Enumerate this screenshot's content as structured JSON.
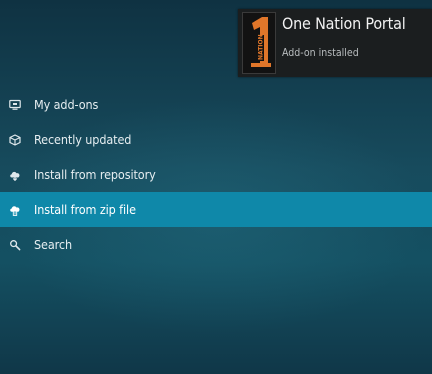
{
  "notification": {
    "title": "One Nation Portal",
    "message": "Add-on installed",
    "logo_icon": "one-nation-logo",
    "logo_accent": "#e0762a"
  },
  "menu": {
    "items": [
      {
        "label": "My add-ons",
        "icon": "monitor-icon",
        "selected": false
      },
      {
        "label": "Recently updated",
        "icon": "box-icon",
        "selected": false
      },
      {
        "label": "Install from repository",
        "icon": "cloud-download-icon",
        "selected": false
      },
      {
        "label": "Install from zip file",
        "icon": "zip-install-icon",
        "selected": true
      },
      {
        "label": "Search",
        "icon": "search-icon",
        "selected": false
      }
    ]
  },
  "colors": {
    "selected_bg": "#0f88a9",
    "background": "#174b5d",
    "toast_bg": "#1b1e1f"
  }
}
